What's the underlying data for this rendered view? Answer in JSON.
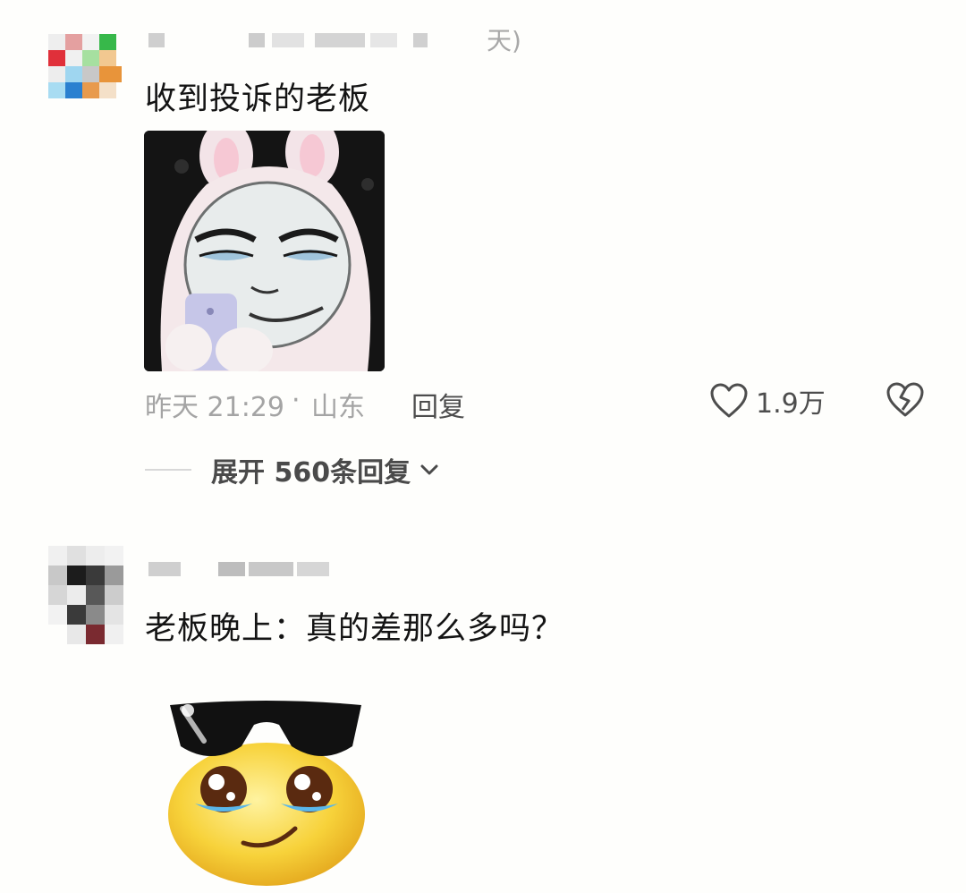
{
  "comments": [
    {
      "username_tail": "天)",
      "text": "收到投诉的老板",
      "sticker": "bunny-smirk-meme",
      "time": "昨天 21:29",
      "location": "山东",
      "separator": "·",
      "reply_label": "回复",
      "like_count": "1.9万",
      "expand_label": "展开 560条回复"
    },
    {
      "username_tail": "",
      "text": "老板晚上：真的差那么多吗？",
      "sticker": "sunglasses-crying-emoji"
    }
  ],
  "colors": {
    "background": "#fefefc",
    "text": "#141414",
    "meta": "#a4a4a4",
    "action": "#4d4d4d"
  },
  "icons": {
    "like": "heart-outline-icon",
    "dislike": "broken-heart-icon",
    "expand": "chevron-down-icon"
  }
}
